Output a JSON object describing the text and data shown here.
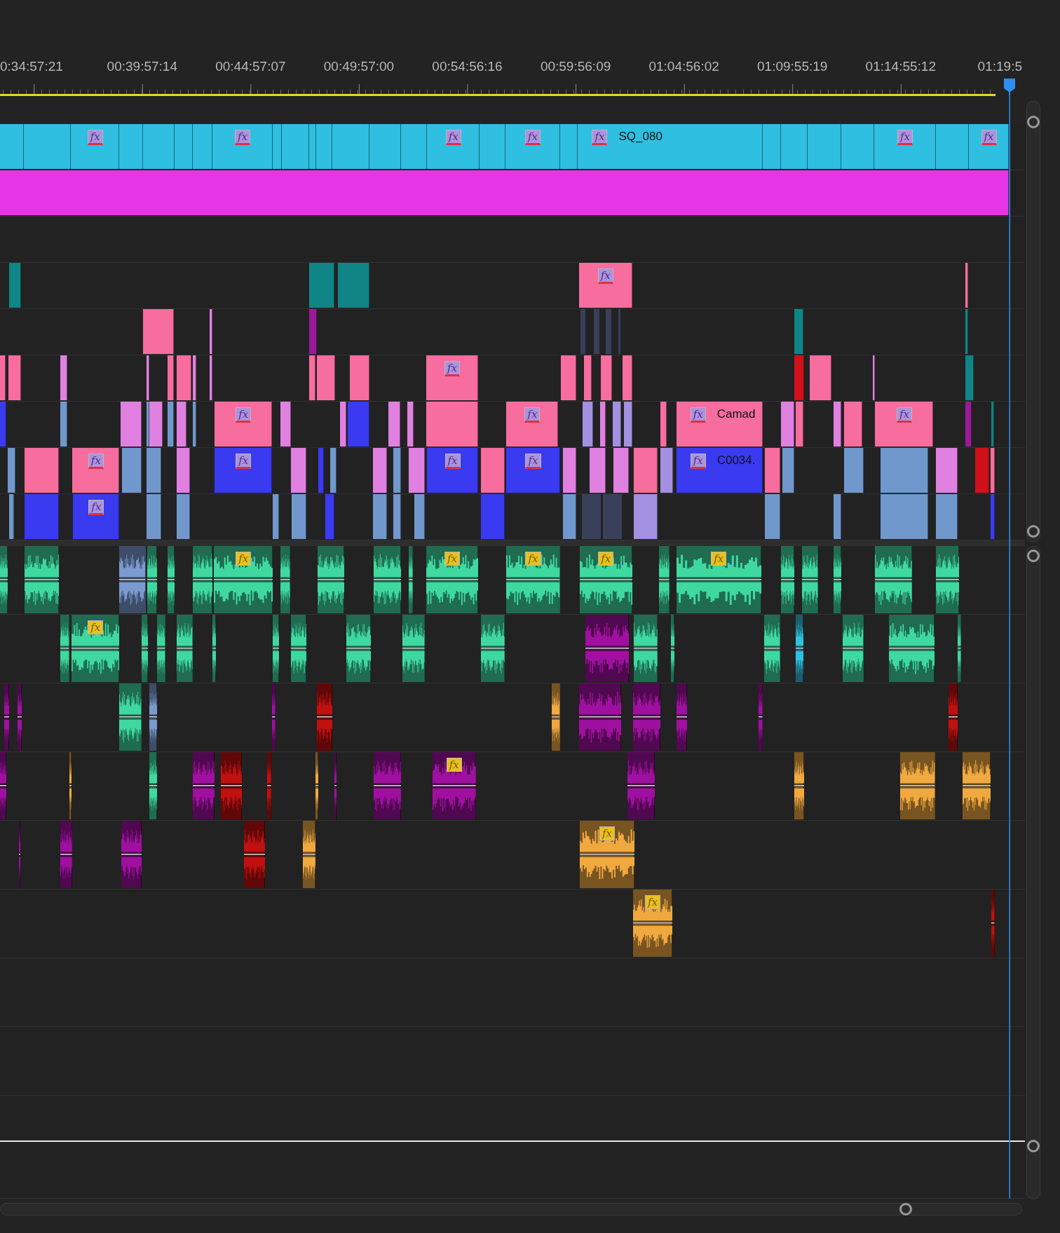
{
  "ruler": {
    "timecodes": [
      "0:34:57:21",
      "00:39:57:14",
      "00:44:57:07",
      "00:49:57:00",
      "00:54:56:16",
      "00:59:56:09",
      "01:04:56:02",
      "01:09:55:19",
      "01:14:55:12",
      "01:19:5"
    ]
  },
  "tracks": [
    {
      "kind": "video",
      "clips": [
        {
          "color": "#2fbfe0"
        },
        {
          "color": "#2fbfe0"
        },
        {
          "color": "#2fbfe0",
          "badge": "fx"
        },
        {
          "color": "#2fbfe0"
        },
        {
          "color": "#2fbfe0"
        },
        {
          "color": "#2fbfe0"
        },
        {
          "color": "#2fbfe0"
        },
        {
          "color": "#2fbfe0",
          "badge": "fx"
        },
        {
          "color": "#2fbfe0"
        },
        {
          "color": "#2fbfe0"
        },
        {
          "color": "#2fbfe0"
        },
        {
          "color": "#2fbfe0"
        },
        {
          "color": "#2fbfe0"
        },
        {
          "color": "#2fbfe0"
        },
        {
          "color": "#2fbfe0"
        },
        {
          "color": "#2fbfe0",
          "badge": "fx"
        },
        {
          "color": "#2fbfe0"
        },
        {
          "color": "#2fbfe0",
          "badge": "fx"
        },
        {
          "color": "#2fbfe0"
        },
        {
          "color": "#2fbfe0",
          "badge": "fx",
          "label": "SQ_080"
        },
        {
          "color": "#2fbfe0"
        },
        {
          "color": "#2fbfe0"
        },
        {
          "color": "#2fbfe0"
        },
        {
          "color": "#2fbfe0"
        },
        {
          "color": "#2fbfe0",
          "badge": "fx"
        },
        {
          "color": "#2fbfe0"
        },
        {
          "color": "#2fbfe0",
          "badge": "fx"
        }
      ]
    },
    {
      "kind": "video",
      "clips": [
        {
          "color": "#e535e5"
        }
      ]
    },
    {
      "kind": "video"
    },
    {
      "kind": "video",
      "clips": [
        {
          "color": "#0f8585"
        },
        {
          "color": "#0f8585"
        },
        {
          "color": "#0f8585"
        },
        {
          "color": "#f66d9e",
          "badge": "fx"
        },
        {
          "color": "#f66d9e"
        }
      ]
    },
    {
      "kind": "video",
      "clips": [
        {
          "color": "#f66d9e"
        },
        {
          "color": "#e080e0"
        },
        {
          "color": "#9a1a9a"
        },
        {
          "color": "#3a3f5a"
        },
        {
          "color": "#3a3f5a"
        },
        {
          "color": "#3a3f5a"
        },
        {
          "color": "#3a3f5a"
        },
        {
          "color": "#0f8585"
        },
        {
          "color": "#0f8585"
        }
      ]
    },
    {
      "kind": "video",
      "clips": [
        {
          "color": "#f66d9e"
        },
        {
          "color": "#f66d9e"
        },
        {
          "color": "#e080e0"
        },
        {
          "color": "#e080e0"
        },
        {
          "color": "#f66d9e"
        },
        {
          "color": "#f66d9e"
        },
        {
          "color": "#e080e0"
        },
        {
          "color": "#e080e0"
        },
        {
          "color": "#f66d9e"
        },
        {
          "color": "#f66d9e"
        },
        {
          "color": "#f66d9e"
        },
        {
          "color": "#f66d9e",
          "badge": "fx"
        },
        {
          "color": "#f66d9e"
        },
        {
          "color": "#f66d9e"
        },
        {
          "color": "#f66d9e"
        },
        {
          "color": "#f66d9e"
        },
        {
          "color": "#d0101a"
        },
        {
          "color": "#f66d9e"
        },
        {
          "color": "#e080e0"
        },
        {
          "color": "#0f8585"
        }
      ]
    },
    {
      "kind": "video",
      "clips": [
        {
          "color": "#3a3af0"
        },
        {
          "color": "#7098cc"
        },
        {
          "color": "#e080e0"
        },
        {
          "color": "#7098cc"
        },
        {
          "color": "#e080e0"
        },
        {
          "color": "#7098cc"
        },
        {
          "color": "#e080e0"
        },
        {
          "color": "#7098cc"
        },
        {
          "color": "#f66d9e",
          "badge": "fx"
        },
        {
          "color": "#e080e0"
        },
        {
          "color": "#e080e0"
        },
        {
          "color": "#3a3af0"
        },
        {
          "color": "#e080e0"
        },
        {
          "color": "#e080e0"
        },
        {
          "color": "#f66d9e"
        },
        {
          "color": "#f66d9e",
          "badge": "fx"
        },
        {
          "color": "#a390e0"
        },
        {
          "color": "#e080e0"
        },
        {
          "color": "#a390e0"
        },
        {
          "color": "#a390e0"
        },
        {
          "color": "#f66d9e"
        },
        {
          "color": "#f66d9e",
          "badge": "fx",
          "label": "Camad"
        },
        {
          "color": "#e080e0"
        },
        {
          "color": "#f66d9e"
        },
        {
          "color": "#e080e0"
        },
        {
          "color": "#f66d9e"
        },
        {
          "color": "#f66d9e",
          "badge": "fx"
        },
        {
          "color": "#9a1a9a"
        },
        {
          "color": "#0f8585"
        }
      ]
    },
    {
      "kind": "video",
      "clips": [
        {
          "color": "#7098cc"
        },
        {
          "color": "#f66d9e"
        },
        {
          "color": "#f66d9e",
          "badge": "fx"
        },
        {
          "color": "#7098cc"
        },
        {
          "color": "#7098cc"
        },
        {
          "color": "#e080e0"
        },
        {
          "color": "#3a3af0",
          "badge": "fx"
        },
        {
          "color": "#e080e0"
        },
        {
          "color": "#3a3af0"
        },
        {
          "color": "#7098cc"
        },
        {
          "color": "#e080e0"
        },
        {
          "color": "#7098cc"
        },
        {
          "color": "#e080e0"
        },
        {
          "color": "#3a3af0",
          "badge": "fx"
        },
        {
          "color": "#f66d9e"
        },
        {
          "color": "#3a3af0",
          "badge": "fx"
        },
        {
          "color": "#e080e0"
        },
        {
          "color": "#e080e0"
        },
        {
          "color": "#e080e0"
        },
        {
          "color": "#f66d9e"
        },
        {
          "color": "#a390e0"
        },
        {
          "color": "#3a3af0",
          "badge": "fx",
          "label": "C0034."
        },
        {
          "color": "#f66d9e"
        },
        {
          "color": "#7098cc"
        },
        {
          "color": "#7098cc"
        },
        {
          "color": "#7098cc"
        },
        {
          "color": "#e080e0"
        },
        {
          "color": "#d0101a"
        },
        {
          "color": "#f66d9e"
        }
      ]
    },
    {
      "kind": "video",
      "clips": [
        {
          "color": "#7098cc"
        },
        {
          "color": "#3a3af0"
        },
        {
          "color": "#3a3af0",
          "badge": "fx"
        },
        {
          "color": "#7098cc"
        },
        {
          "color": "#7098cc"
        },
        {
          "color": "#7098cc"
        },
        {
          "color": "#7098cc"
        },
        {
          "color": "#3a3af0"
        },
        {
          "color": "#7098cc"
        },
        {
          "color": "#7098cc"
        },
        {
          "color": "#7098cc"
        },
        {
          "color": "#3a3af0"
        },
        {
          "color": "#7098cc"
        },
        {
          "color": "#3a3f5a"
        },
        {
          "color": "#3a3f5a"
        },
        {
          "color": "#a390e0"
        },
        {
          "color": "#7098cc"
        },
        {
          "color": "#7098cc"
        },
        {
          "color": "#7098cc"
        },
        {
          "color": "#7098cc"
        },
        {
          "color": "#3a3af0"
        }
      ]
    },
    {
      "kind": "audio",
      "clips": [
        {
          "color": "#3fd9a0"
        },
        {
          "color": "#3fd9a0"
        },
        {
          "color": "#7a9ad0"
        },
        {
          "color": "#3fd9a0"
        },
        {
          "color": "#3fd9a0"
        },
        {
          "color": "#3fd9a0"
        },
        {
          "color": "#3fd9a0",
          "badge": "fx"
        },
        {
          "color": "#3fd9a0"
        },
        {
          "color": "#3fd9a0"
        },
        {
          "color": "#3fd9a0"
        },
        {
          "color": "#3fd9a0"
        },
        {
          "color": "#3fd9a0",
          "badge": "fx"
        },
        {
          "color": "#3fd9a0",
          "badge": "fx"
        },
        {
          "color": "#3fd9a0",
          "badge": "fx"
        },
        {
          "color": "#3fd9a0"
        },
        {
          "color": "#3fd9a0",
          "badge": "fx"
        },
        {
          "color": "#3fd9a0"
        },
        {
          "color": "#3fd9a0"
        },
        {
          "color": "#3fd9a0"
        },
        {
          "color": "#3fd9a0"
        },
        {
          "color": "#3fd9a0"
        }
      ]
    },
    {
      "kind": "audio",
      "clips": [
        {
          "color": "#3fd9a0"
        },
        {
          "color": "#3fd9a0",
          "badge": "fx"
        },
        {
          "color": "#3fd9a0"
        },
        {
          "color": "#3fd9a0"
        },
        {
          "color": "#3fd9a0"
        },
        {
          "color": "#3fd9a0"
        },
        {
          "color": "#3fd9a0"
        },
        {
          "color": "#3fd9a0"
        },
        {
          "color": "#3fd9a0"
        },
        {
          "color": "#3fd9a0"
        },
        {
          "color": "#3fd9a0"
        },
        {
          "color": "#a010a0"
        },
        {
          "color": "#3fd9a0"
        },
        {
          "color": "#3fd9a0"
        },
        {
          "color": "#3fd9a0"
        },
        {
          "color": "#30c0e0"
        },
        {
          "color": "#3fd9a0"
        },
        {
          "color": "#3fd9a0"
        },
        {
          "color": "#3fd9a0"
        }
      ]
    },
    {
      "kind": "audio",
      "clips": [
        {
          "color": "#a010a0"
        },
        {
          "color": "#a010a0"
        },
        {
          "color": "#3fd9a0"
        },
        {
          "color": "#7a9ad0"
        },
        {
          "color": "#a010a0"
        },
        {
          "color": "#c01010"
        },
        {
          "color": "#f0a840"
        },
        {
          "color": "#a010a0"
        },
        {
          "color": "#a010a0"
        },
        {
          "color": "#a010a0"
        },
        {
          "color": "#a010a0"
        },
        {
          "color": "#c01010"
        }
      ]
    },
    {
      "kind": "audio",
      "clips": [
        {
          "color": "#a010a0"
        },
        {
          "color": "#f0a840"
        },
        {
          "color": "#3fd9a0"
        },
        {
          "color": "#a010a0"
        },
        {
          "color": "#c01010"
        },
        {
          "color": "#c01010"
        },
        {
          "color": "#f0a840"
        },
        {
          "color": "#a010a0"
        },
        {
          "color": "#a010a0"
        },
        {
          "color": "#a010a0",
          "badge": "fx"
        },
        {
          "color": "#a010a0"
        },
        {
          "color": "#f0a840"
        },
        {
          "color": "#f0a840"
        },
        {
          "color": "#f0a840"
        }
      ]
    },
    {
      "kind": "audio",
      "clips": [
        {
          "color": "#a010a0"
        },
        {
          "color": "#a010a0"
        },
        {
          "color": "#a010a0"
        },
        {
          "color": "#c01010"
        },
        {
          "color": "#f0a840"
        },
        {
          "color": "#f0a840",
          "badge": "fx"
        }
      ]
    },
    {
      "kind": "audio",
      "clips": [
        {
          "color": "#f0a840",
          "badge": "fx"
        },
        {
          "color": "#c01010"
        }
      ]
    },
    {
      "kind": "audio"
    },
    {
      "kind": "audio"
    },
    {
      "kind": "master"
    }
  ]
}
